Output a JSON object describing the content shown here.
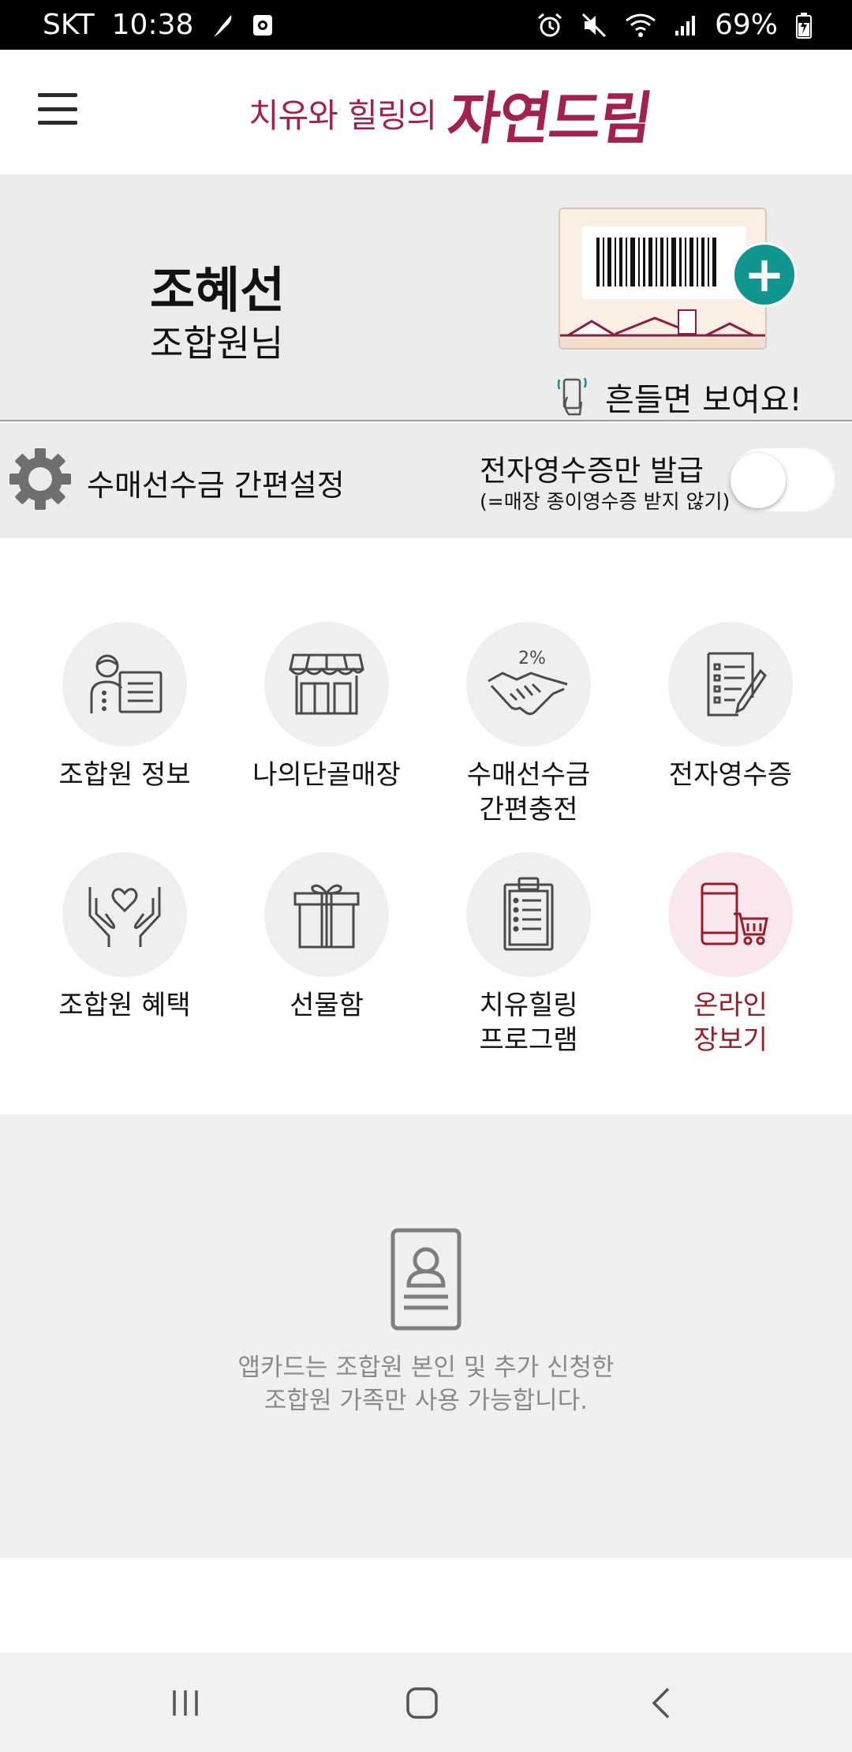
{
  "status_bar": {
    "carrier": "SKT",
    "time": "10:38",
    "battery": "69%"
  },
  "header": {
    "brand_small": "치유와 힐링의",
    "brand_big": "자연드림"
  },
  "member": {
    "name": "조혜선",
    "subtitle": "조합원님",
    "shake_hint": "흔들면 보여요!"
  },
  "settings": {
    "easy_setting_label": "수매선수금 간편설정",
    "e_receipt_label": "전자영수증만 발급",
    "e_receipt_sub": "(=매장 종이영수증 받지 않기)",
    "e_receipt_enabled": false
  },
  "menu": {
    "items": [
      {
        "label": "조합원 정보",
        "icon": "member-info-icon"
      },
      {
        "label": "나의단골매장",
        "icon": "store-icon"
      },
      {
        "label": "수매선수금\n간편충전",
        "icon": "handshake-2percent-icon"
      },
      {
        "label": "전자영수증",
        "icon": "receipt-pen-icon"
      },
      {
        "label": "조합원 혜택",
        "icon": "hands-heart-icon"
      },
      {
        "label": "선물함",
        "icon": "gift-box-icon"
      },
      {
        "label": "치유힐링\n프로그램",
        "icon": "clipboard-icon"
      },
      {
        "label": "온라인\n장보기",
        "icon": "phone-cart-icon"
      }
    ]
  },
  "notice": {
    "line1": "앱카드는 조합원 본인 및 추가 신청한",
    "line2": "조합원 가족만 사용 가능합니다."
  },
  "colors": {
    "brand": "#a3214e",
    "teal": "#10958f",
    "online_red": "#9b1b27"
  }
}
